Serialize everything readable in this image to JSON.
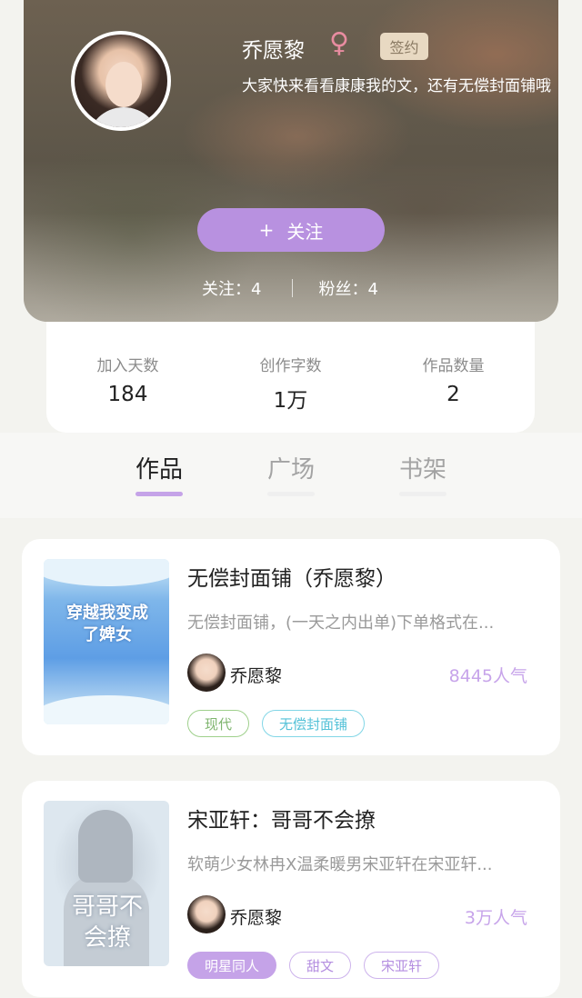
{
  "profile": {
    "name": "乔愿黎",
    "gender_symbol": "♀",
    "badge": "签约",
    "bio": "大家快来看看康康我的文，还有无偿封面铺哦",
    "follow_label": "关注",
    "follow_icon": "+",
    "following_label": "关注：4",
    "fans_label": "粉丝：4"
  },
  "stats": [
    {
      "label": "加入天数",
      "value": "184"
    },
    {
      "label": "创作字数",
      "value": "1万"
    },
    {
      "label": "作品数量",
      "value": "2"
    }
  ],
  "tabs": [
    {
      "label": "作品",
      "active": true
    },
    {
      "label": "广场",
      "active": false
    },
    {
      "label": "书架",
      "active": false
    }
  ],
  "books": [
    {
      "title": "无偿封面铺（乔愿黎）",
      "cover_text": "穿越我变成了婢女",
      "description": "无偿封面铺，(一天之内出单)下单格式在...",
      "author": "乔愿黎",
      "popularity": "8445人气",
      "tags": [
        "现代",
        "无偿封面铺"
      ]
    },
    {
      "title": "宋亚轩：哥哥不会撩",
      "cover_text": "哥哥不会撩",
      "description": "软萌少女林冉X温柔暖男宋亚轩在宋亚轩...",
      "author": "乔愿黎",
      "popularity": "3万人气",
      "tags": [
        "明星同人",
        "甜文",
        "宋亚轩"
      ]
    }
  ],
  "colors": {
    "accent": "#b891e0",
    "tab_indicator": "#c5a3e8",
    "popularity": "#c7a4ea",
    "badge_bg": "#e8d9c2"
  }
}
